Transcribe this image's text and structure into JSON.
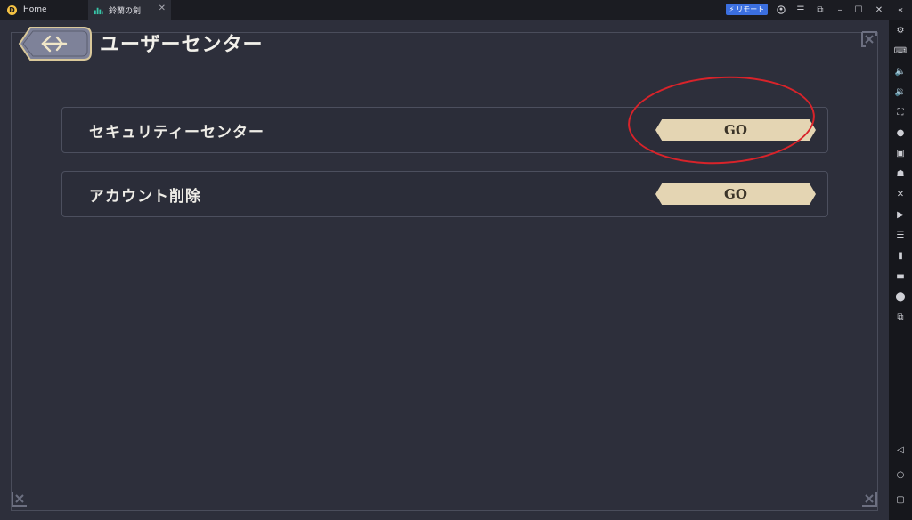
{
  "titlebar": {
    "home_tab": "Home",
    "game_tab": "鈴蘭の剣",
    "remote_label": "リモート"
  },
  "page": {
    "title": "ユーザーセンター"
  },
  "rows": [
    {
      "label": "セキュリティーセンター",
      "button": "GO"
    },
    {
      "label": "アカウント削除",
      "button": "GO"
    }
  ],
  "colors": {
    "accent_button": "#e4d5b3",
    "annotation": "#d8232a",
    "background": "#2d2f3b"
  },
  "icons": {
    "sidebar": [
      "settings-icon",
      "keyboard-icon",
      "volume-up-icon",
      "volume-down-icon",
      "screenshot-icon",
      "macro-icon",
      "sync-icon",
      "robot-icon",
      "cross-swords-icon",
      "record-icon",
      "script-icon",
      "apk-icon",
      "folder-icon",
      "location-icon",
      "multi-instance-icon",
      "back-icon",
      "home-icon",
      "recent-icon"
    ]
  }
}
